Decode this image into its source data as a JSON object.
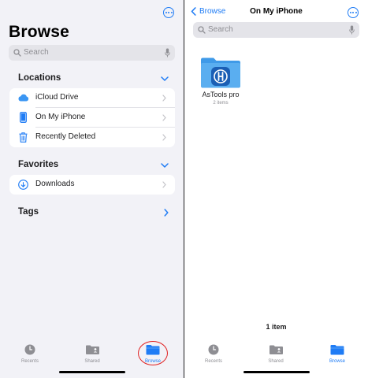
{
  "colors": {
    "accent": "#1f7cf5",
    "annotation": "#e02020",
    "folder": "#5aaef0"
  },
  "left": {
    "title": "Browse",
    "search": {
      "placeholder": "Search"
    },
    "locations": {
      "header": "Locations",
      "items": [
        {
          "label": "iCloud Drive",
          "icon": "icloud-icon"
        },
        {
          "label": "On My iPhone",
          "icon": "iphone-icon"
        },
        {
          "label": "Recently Deleted",
          "icon": "trash-icon"
        }
      ]
    },
    "favorites": {
      "header": "Favorites",
      "items": [
        {
          "label": "Downloads",
          "icon": "download-icon"
        }
      ]
    },
    "tags": {
      "header": "Tags"
    },
    "tabs": [
      {
        "label": "Recents",
        "icon": "clock-icon",
        "active": false
      },
      {
        "label": "Shared",
        "icon": "shared-folder-icon",
        "active": false
      },
      {
        "label": "Browse",
        "icon": "folder-icon",
        "active": true
      }
    ]
  },
  "right": {
    "back_label": "Browse",
    "title": "On My iPhone",
    "search": {
      "placeholder": "Search"
    },
    "folder": {
      "name": "AsTools pro",
      "count": "2 items",
      "icon": "astools-logo-icon"
    },
    "item_count": "1 item",
    "tabs": [
      {
        "label": "Recents",
        "icon": "clock-icon",
        "active": false
      },
      {
        "label": "Shared",
        "icon": "shared-folder-icon",
        "active": false
      },
      {
        "label": "Browse",
        "icon": "folder-icon",
        "active": true
      }
    ]
  }
}
